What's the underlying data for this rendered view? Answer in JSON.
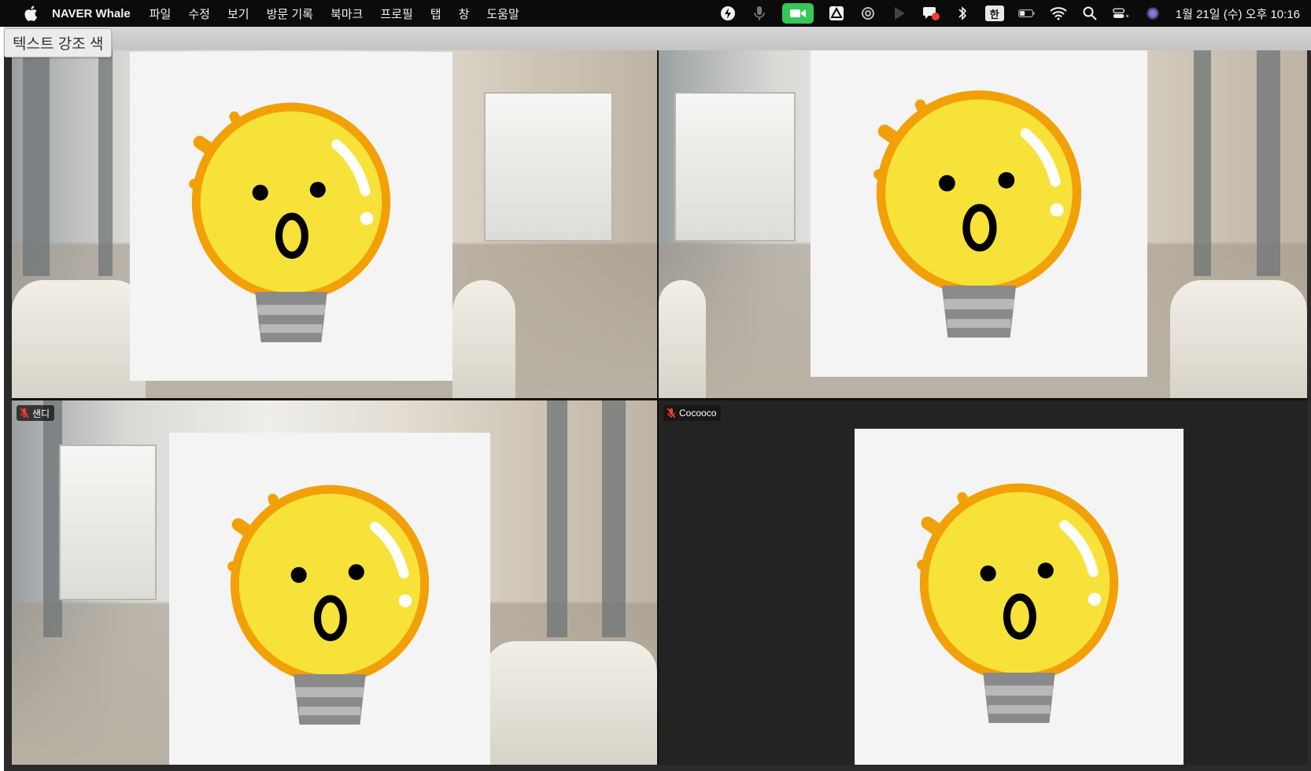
{
  "menubar": {
    "app_name": "NAVER Whale",
    "items": [
      "파일",
      "수정",
      "보기",
      "방문 기록",
      "북마크",
      "프로필",
      "탭",
      "창",
      "도움말"
    ],
    "status_icons": [
      "bolt-icon",
      "microphone-icon",
      "camera-icon",
      "drive-icon",
      "cloud-icon",
      "play-icon",
      "chat-icon",
      "bluetooth-icon",
      "input-method-icon",
      "battery-icon",
      "wifi-icon",
      "search-icon",
      "control-center-icon",
      "siri-icon"
    ],
    "input_method_label": "한",
    "clock": "1월 21일 (수) 오후 10:16"
  },
  "tooltip": {
    "text": "텍스트 강조 색"
  },
  "participants": [
    {
      "name": "",
      "muted": false,
      "background": "lobby",
      "avatar": "lightbulb-avatar"
    },
    {
      "name": "",
      "muted": false,
      "background": "lobby",
      "avatar": "lightbulb-avatar"
    },
    {
      "name": "샌디",
      "muted": true,
      "background": "lobby",
      "avatar": "lightbulb-avatar"
    },
    {
      "name": "Cocooco",
      "muted": true,
      "background": "dark",
      "avatar": "lightbulb-avatar"
    }
  ],
  "colors": {
    "camera_active": "#35c759",
    "bulb_yellow": "#f7e23a",
    "bulb_outline": "#f2a007",
    "tile_dark": "#232323"
  }
}
